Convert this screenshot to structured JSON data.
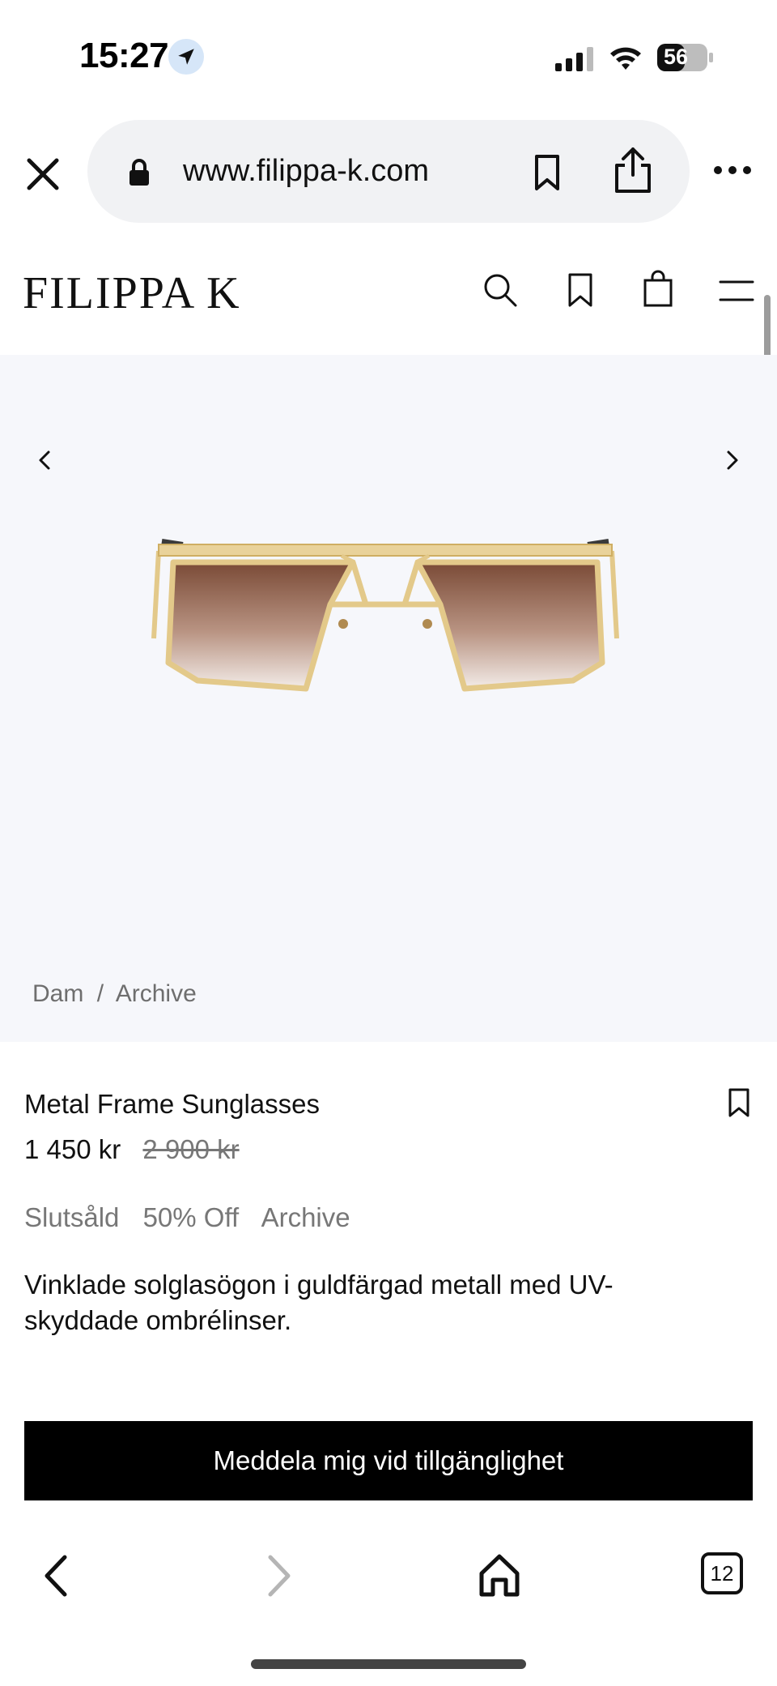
{
  "status": {
    "time": "15:27",
    "battery": "56"
  },
  "browser": {
    "url": "www.filippa-k.com",
    "tab_count": "12"
  },
  "site": {
    "logo": "FILIPPA K"
  },
  "breadcrumb": {
    "items": [
      "Dam",
      "Archive"
    ],
    "separator": "/"
  },
  "product": {
    "title": "Metal Frame Sunglasses",
    "price": "1 450 kr",
    "original_price": "2 900 kr",
    "tags": [
      "Slutsåld",
      "50% Off",
      "Archive"
    ],
    "description": "Vinklade solglasögon i guldfärgad metall med UV-skyddade ombrélinser.",
    "cta_label": "Meddela mig vid tillgänglighet"
  },
  "colors": {
    "accent": "#000000",
    "hero_background": "#f6f7fb",
    "muted_text": "#777777",
    "frame_gold": "#e3c98a",
    "lens_brown": "#8a5a44"
  },
  "icons": {
    "location": "location-arrow-icon",
    "signal": "signal-icon",
    "wifi": "wifi-icon",
    "battery": "battery-icon",
    "close": "close-icon",
    "lock": "lock-icon",
    "bookmark": "bookmark-icon",
    "share": "share-icon",
    "more": "more-icon",
    "search": "search-icon",
    "bag": "shopping-bag-icon",
    "menu": "hamburger-menu-icon",
    "prev": "chevron-left-icon",
    "next": "chevron-right-icon",
    "home": "home-icon",
    "tabs": "tabs-icon"
  }
}
